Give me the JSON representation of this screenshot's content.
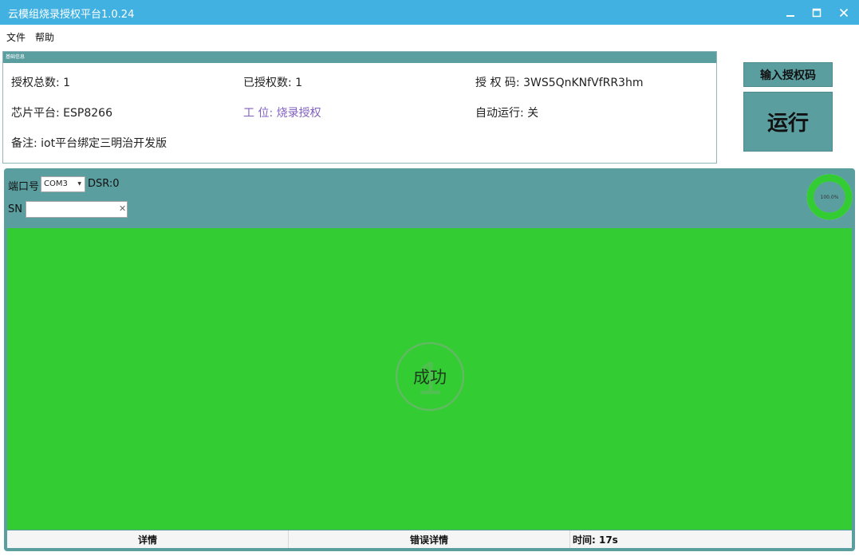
{
  "window": {
    "title": "云模组烧录授权平台1.0.24"
  },
  "menu": {
    "items": [
      {
        "label": "文件"
      },
      {
        "label": "帮助"
      }
    ]
  },
  "info_panel": {
    "header": "基础信息",
    "fields": {
      "total_auth": "授权总数: 1",
      "authorized_count": "已授权数: 1",
      "auth_code": "授 权 码: 3WS5QnKNfVfRR3hm",
      "chip_platform": "芯片平台: ESP8266",
      "station": "工 位: 烧录授权",
      "auto_run": "自动运行: 关",
      "remark": "备注: iot平台绑定三明治开发版"
    },
    "colors": {
      "header": "#5b9ea0",
      "station_text": "#8060c0"
    }
  },
  "actions": {
    "enter_auth_label": "输入授权码",
    "run_label": "运行"
  },
  "port_panel": {
    "port_label": "端口号",
    "port_value": "COM3",
    "dsr_label": "DSR:0",
    "sn_label": "SN",
    "sn_value": "",
    "progress_text": "100.0%",
    "progress_percent": 100,
    "colors": {
      "panel": "#5b9ea0",
      "progress": "#33cc33",
      "success": "#33cc33"
    }
  },
  "result": {
    "text": "成功",
    "digit": "1"
  },
  "status_bar": {
    "details_label": "详情",
    "error_details_label": "错误详情",
    "time_text": "时间:  17s"
  },
  "icons": {
    "minimize": "minimize-icon",
    "maximize": "maximize-icon",
    "close": "close-icon",
    "dropdown": "chevron-down-icon",
    "clear": "clear-icon"
  }
}
